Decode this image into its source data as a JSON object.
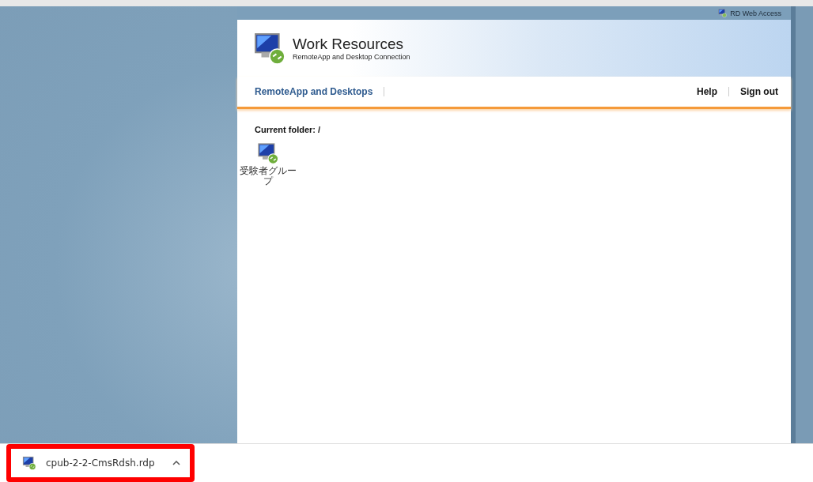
{
  "top_bar": {
    "label": "RD Web Access"
  },
  "header": {
    "title": "Work Resources",
    "subtitle": "RemoteApp and Desktop Connection"
  },
  "nav": {
    "tabs": [
      {
        "label": "RemoteApp and Desktops",
        "selected": true
      }
    ],
    "links": [
      "Help",
      "Sign out"
    ]
  },
  "content": {
    "folder_label": "Current folder: /",
    "items": [
      {
        "label": "受験者グループ"
      }
    ]
  },
  "download_bar": {
    "file": "cpub-2-2-CmsRdsh.rdp",
    "highlighted": true
  }
}
